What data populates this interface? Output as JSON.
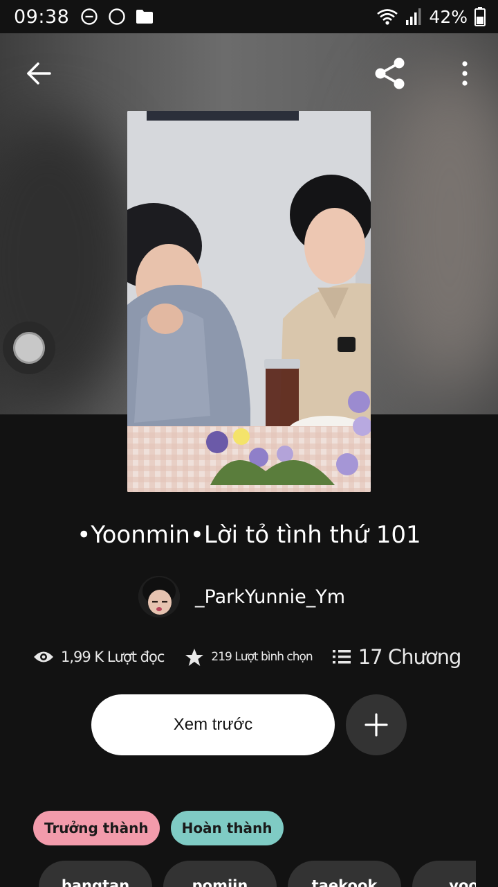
{
  "status_bar": {
    "time": "09:38",
    "battery": "42%"
  },
  "story": {
    "title": "•Yoonmin•Lời tỏ tình thứ 101",
    "author": "_ParkYunnie_Ym",
    "reads": "1,99 K Lượt đọc",
    "votes": "219 Lượt bình chọn",
    "chapters": "17 Chương"
  },
  "actions": {
    "preview_label": "Xem trước",
    "add_label": "+"
  },
  "tags": [
    {
      "label": "Trưởng thành",
      "color": "#f29bab"
    },
    {
      "label": "Hoàn thành",
      "color": "#7fcbc4"
    }
  ],
  "hashtags": [
    "bangtan",
    "pomjin",
    "taekook",
    "yoon"
  ],
  "colors": {
    "background": "#121212",
    "button_bg": "#ffffff",
    "chip_bg": "#333333"
  },
  "icons": {
    "back": "arrow-left-icon",
    "share": "share-icon",
    "more": "more-vertical-icon",
    "reads": "eye-icon",
    "votes": "star-icon",
    "chapters": "list-icon",
    "add": "plus-icon"
  }
}
